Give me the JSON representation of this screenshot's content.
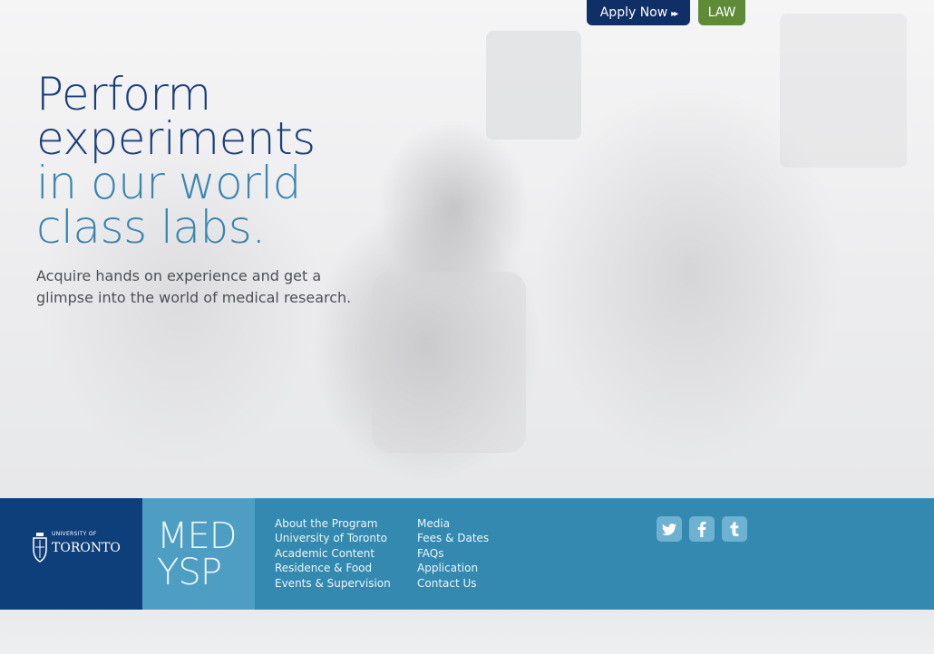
{
  "header": {
    "apply_label": "Apply Now",
    "apply_arrows": "▸▸",
    "law_label": "LAW"
  },
  "hero": {
    "headline_lines": [
      "Perform",
      "experiments",
      "in our world",
      "class labs."
    ],
    "subtext": "Acquire hands on experience and get a glimpse into the world of medical research."
  },
  "footer": {
    "uoft_small": "UNIVERSITY OF",
    "uoft_big": "TORONTO",
    "medysp_line1": "MED",
    "medysp_line2": "YSP",
    "nav_col1": [
      "About the Program",
      "University of Toronto",
      "Academic Content",
      "Residence & Food",
      "Events & Supervision"
    ],
    "nav_col2": [
      "Media",
      "Fees & Dates",
      "FAQs",
      "Application",
      "Contact Us"
    ],
    "social": [
      "twitter-icon",
      "facebook-icon",
      "tumblr-icon"
    ]
  },
  "colors": {
    "navy": "#0f2f66",
    "law_green": "#5f8a36",
    "headline_dark": "#1b3f78",
    "headline_light": "#3a86ad",
    "footer_blue": "#3389b0",
    "uoft_blue": "#0f3f7a",
    "medysp_blue": "#4e9ec3"
  }
}
